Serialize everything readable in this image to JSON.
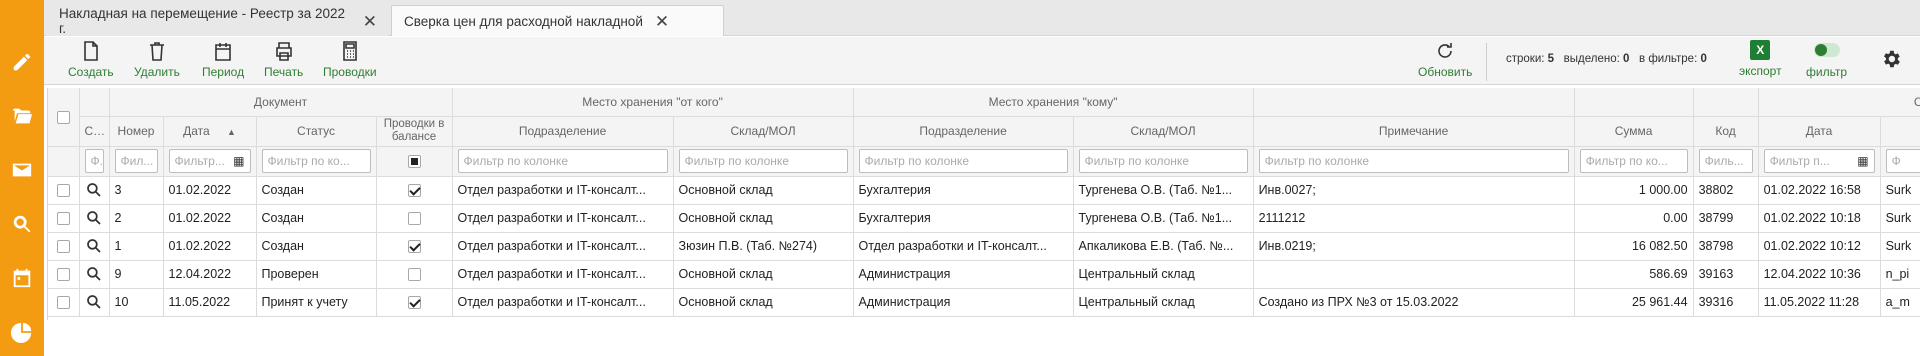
{
  "tabs": [
    {
      "label": "Накладная на перемещение - Реестр за 2022 г."
    },
    {
      "label": "Сверка цен для расходной накладной"
    }
  ],
  "tab_close": "✕",
  "toolbar": {
    "create": "Создать",
    "delete": "Удалить",
    "period": "Период",
    "print": "Печать",
    "postings": "Проводки",
    "refresh": "Обновить",
    "rows_label": "строки:",
    "rows_value": "5",
    "selected_label": "выделено:",
    "selected_value": "0",
    "filtered_label": "в фильтре:",
    "filtered_value": "0",
    "export": "экспорт",
    "filter": "фильтр"
  },
  "grid": {
    "groups": {
      "document": "Документ",
      "from": "Место хранения \"от кого\"",
      "to": "Место хранения \"кому\"",
      "extra": "С"
    },
    "columns": {
      "cont": "Сод.",
      "number": "Номер",
      "date": "Дата",
      "status": "Статус",
      "postings": "Проводки в балансе",
      "from_dept": "Подразделение",
      "from_store": "Склад/МОЛ",
      "to_dept": "Подразделение",
      "to_store": "Склад/МОЛ",
      "note": "Примечание",
      "sum": "Сумма",
      "code": "Код",
      "date2": "Дата"
    },
    "filters": {
      "cont": "Ф.",
      "number": "Фил...",
      "date": "Фильтр...",
      "status": "Фильтр по ко...",
      "full": "Фильтр по колонке",
      "sum": "Фильтр по ко...",
      "code": "Филь...",
      "date2": "Фильтр п...",
      "extra": "Ф"
    },
    "rows": [
      {
        "number": "3",
        "date": "01.02.2022",
        "status": "Создан",
        "posted": true,
        "from_dept": "Отдел разработки и IT-консалт...",
        "from_store": "Основной склад",
        "to_dept": "Бухгалтерия",
        "to_store": "Тургенева О.В. (Таб. №1...",
        "note": "Инв.0027;",
        "sum": "1 000.00",
        "code": "38802",
        "date2": "01.02.2022 16:58",
        "user": "Surk"
      },
      {
        "number": "2",
        "date": "01.02.2022",
        "status": "Создан",
        "posted": false,
        "from_dept": "Отдел разработки и IT-консалт...",
        "from_store": "Основной склад",
        "to_dept": "Бухгалтерия",
        "to_store": "Тургенева О.В. (Таб. №1...",
        "note": "2111212",
        "sum": "0.00",
        "code": "38799",
        "date2": "01.02.2022 10:18",
        "user": "Surk"
      },
      {
        "number": "1",
        "date": "01.02.2022",
        "status": "Создан",
        "posted": true,
        "from_dept": "Отдел разработки и IT-консалт...",
        "from_store": "Зюзин П.В. (Таб. №274)",
        "to_dept": "Отдел разработки и IT-консалт...",
        "to_store": "Апкаликова Е.В. (Таб. №...",
        "note": "Инв.0219;",
        "sum": "16 082.50",
        "code": "38798",
        "date2": "01.02.2022 10:12",
        "user": "Surk"
      },
      {
        "number": "9",
        "date": "12.04.2022",
        "status": "Проверен",
        "posted": false,
        "from_dept": "Отдел разработки и IT-консалт...",
        "from_store": "Основной склад",
        "to_dept": "Администрация",
        "to_store": "Центральный склад",
        "note": "",
        "sum": "586.69",
        "code": "39163",
        "date2": "12.04.2022 10:36",
        "user": "n_pi"
      },
      {
        "number": "10",
        "date": "11.05.2022",
        "status": "Принят к учету",
        "posted": true,
        "from_dept": "Отдел разработки и IT-консалт...",
        "from_store": "Основной склад",
        "to_dept": "Администрация",
        "to_store": "Центральный склад",
        "note": "Создано из ПРХ №3 от 15.03.2022",
        "sum": "25 961.44",
        "code": "39316",
        "date2": "11.05.2022 11:28",
        "user": "a_m"
      }
    ]
  },
  "colors": {
    "sidebar": "#f39c12",
    "accent_green": "#2e7d32",
    "excel_green": "#1e7e34"
  },
  "icons": [
    "edit-icon",
    "folder-icon",
    "mail-icon",
    "search-icon",
    "calendar-icon",
    "pie-chart-icon"
  ]
}
